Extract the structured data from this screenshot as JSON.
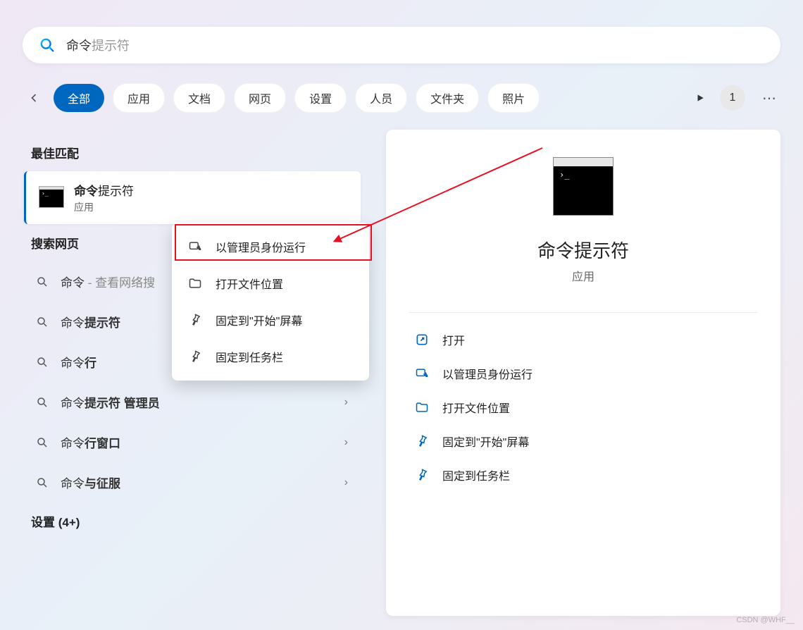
{
  "search": {
    "typed": "命令",
    "ghost": "提示符"
  },
  "tabs": {
    "items": [
      "全部",
      "应用",
      "文档",
      "网页",
      "设置",
      "人员",
      "文件夹",
      "照片"
    ],
    "active_index": 0,
    "badge": "1"
  },
  "sections": {
    "best_match": "最佳匹配",
    "search_web": "搜索网页",
    "settings": "设置 (4+)"
  },
  "best_result": {
    "title_bold": "命令",
    "title_rest": "提示符",
    "subtitle": "应用"
  },
  "web_results": [
    {
      "prefix": "命令",
      "bold": "",
      "suffix": " - 查看网络搜",
      "chevron": false
    },
    {
      "prefix": "命令",
      "bold": "提示符",
      "suffix": "",
      "chevron": true
    },
    {
      "prefix": "命令",
      "bold": "行",
      "suffix": "",
      "chevron": true
    },
    {
      "prefix": "命令",
      "bold": "提示符 管理员",
      "suffix": "",
      "chevron": true
    },
    {
      "prefix": "命令",
      "bold": "行窗口",
      "suffix": "",
      "chevron": true
    },
    {
      "prefix": "命令",
      "bold": "与征服",
      "suffix": "",
      "chevron": true
    }
  ],
  "context_menu": [
    {
      "icon": "admin-run-icon",
      "label": "以管理员身份运行"
    },
    {
      "icon": "folder-icon",
      "label": "打开文件位置"
    },
    {
      "icon": "pin-icon",
      "label": "固定到\"开始\"屏幕"
    },
    {
      "icon": "pin-icon",
      "label": "固定到任务栏"
    }
  ],
  "right_panel": {
    "title": "命令提示符",
    "subtitle": "应用",
    "actions": [
      {
        "icon": "open-icon",
        "label": "打开"
      },
      {
        "icon": "admin-run-icon",
        "label": "以管理员身份运行"
      },
      {
        "icon": "folder-icon",
        "label": "打开文件位置"
      },
      {
        "icon": "pin-icon",
        "label": "固定到\"开始\"屏幕"
      },
      {
        "icon": "pin-icon",
        "label": "固定到任务栏"
      }
    ]
  },
  "watermark": "CSDN @WHF__"
}
